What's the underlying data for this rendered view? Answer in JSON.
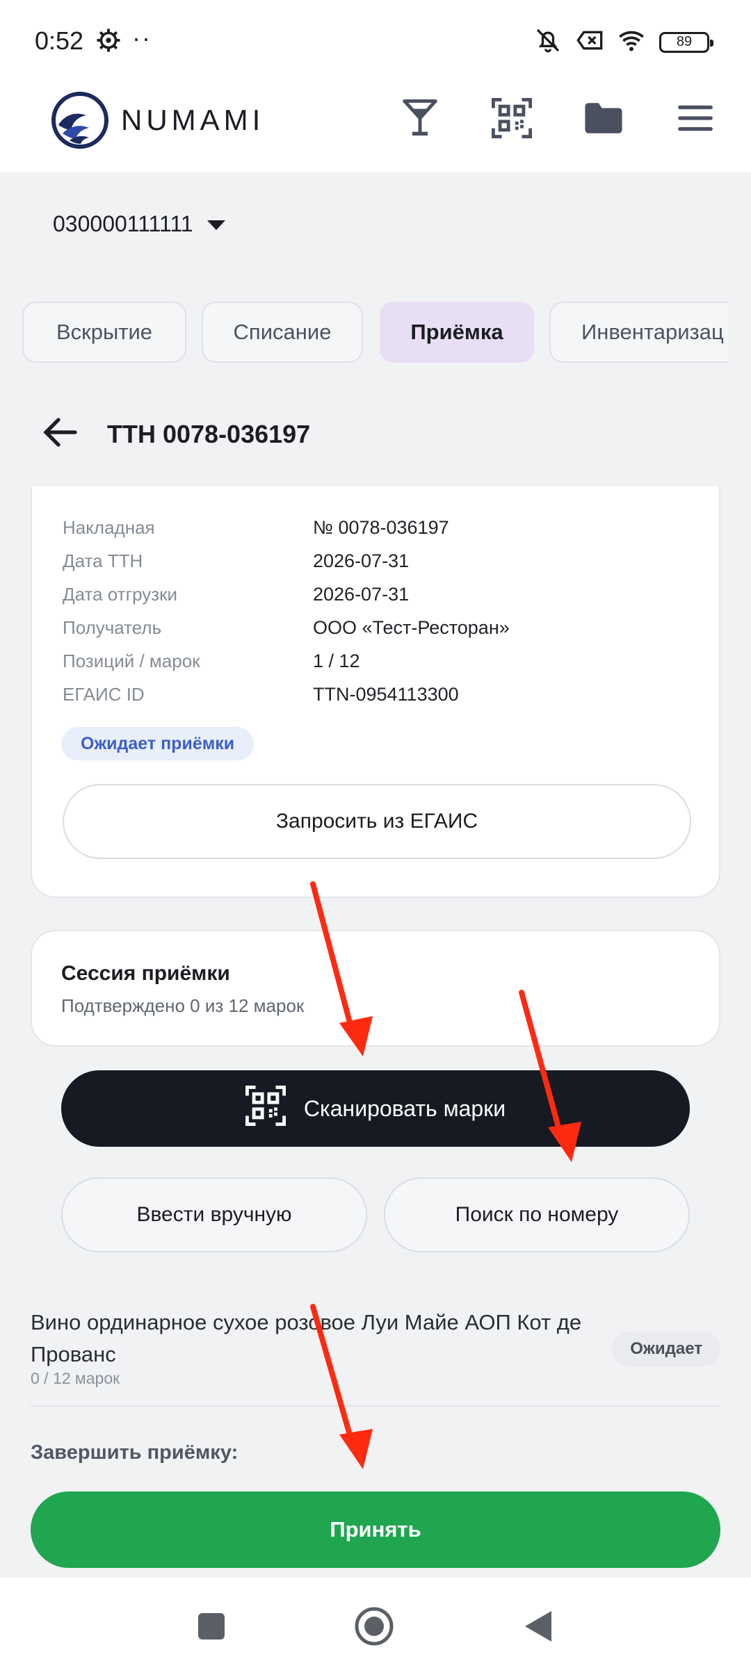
{
  "status_bar": {
    "time": "0:52",
    "dots": "··",
    "battery": "89",
    "icons": [
      "gear-icon",
      "muted-bell-icon",
      "sim-off-icon",
      "wifi-icon",
      "battery-icon"
    ]
  },
  "app_bar": {
    "logo_text": "NUMAMI",
    "icons": [
      "cocktail-glass-icon",
      "qr-code-icon",
      "folder-icon",
      "menu-icon"
    ]
  },
  "store_selector": {
    "value": "030000111111"
  },
  "tabs": [
    {
      "label": "Вскрытие",
      "active": false
    },
    {
      "label": "Списание",
      "active": false
    },
    {
      "label": "Приёмка",
      "active": true
    },
    {
      "label": "Инвентаризац",
      "active": false
    }
  ],
  "header": {
    "title": "ТТН 0078-036197"
  },
  "invoice": {
    "rows": [
      {
        "label": "Накладная",
        "value": "№ 0078-036197"
      },
      {
        "label": "Дата ТТН",
        "value": "2026-07-31"
      },
      {
        "label": "Дата отгрузки",
        "value": "2026-07-31"
      },
      {
        "label": "Получатель",
        "value": "ООО «Тест-Ресторан»"
      },
      {
        "label": "Позиций / марок",
        "value": "1 / 12"
      },
      {
        "label": "ЕГАИС ID",
        "value": "TTN-0954113300"
      }
    ],
    "status_badge": "Ожидает приёмки",
    "request_button": "Запросить из ЕГАИС"
  },
  "session": {
    "title": "Сессия приёмки",
    "subtitle": "Подтверждено 0 из 12 марок"
  },
  "actions": {
    "scan_button": "Сканировать марки",
    "manual_button": "Ввести вручную",
    "search_button": "Поиск по номеру"
  },
  "products": [
    {
      "name": "Вино ординарное сухое розовое Луи Майе АОП Кот де Прованс",
      "count": "0 / 12 марок",
      "status": "Ожидает"
    }
  ],
  "finish": {
    "label": "Завершить приёмку:",
    "accept_button": "Принять"
  },
  "colors": {
    "accent_tab": "#e8dff5",
    "scan_button": "#161a22",
    "accept_button": "#1fa64f",
    "badge_text": "#3c5fc5",
    "annotation_arrows": "#ff2a10"
  }
}
